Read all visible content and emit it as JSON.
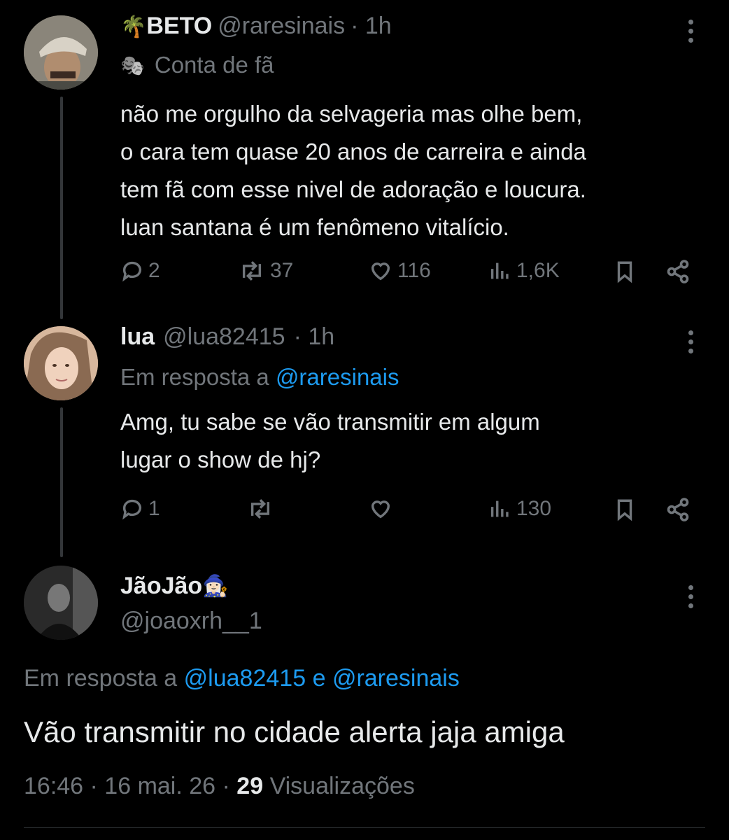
{
  "tweets": [
    {
      "display_name": "BETO",
      "name_emoji": "🌴",
      "handle": "@raresinais",
      "time": "· 1h",
      "label_emoji": "🎭",
      "label": "Conta de fã",
      "body": [
        "não me orgulho da selvageria mas olhe bem,",
        "o cara tem quase 20 anos de carreira e ainda",
        "tem fã com esse nivel de adoração e loucura.",
        "luan santana é um fenômeno vitalício."
      ],
      "stats": {
        "replies": "2",
        "retweets": "37",
        "likes": "116",
        "views": "1,6K"
      }
    },
    {
      "display_name": "lua",
      "handle": "@lua82415",
      "time": "· 1h",
      "reply_prefix": "Em resposta a",
      "reply_to": "@raresinais",
      "body": [
        "Amg, tu sabe se vão transmitir em algum",
        "lugar o show de hj?"
      ],
      "stats": {
        "replies": "1",
        "retweets": "",
        "likes": "",
        "views": "130"
      }
    }
  ],
  "main_tweet": {
    "display_name": "JãoJão",
    "name_emoji": "🧙🏻‍♀️",
    "handle": "@joaoxrh__1",
    "reply_prefix": "Em resposta a",
    "reply_to_1": "@lua82415",
    "reply_joiner": "e",
    "reply_to_2": "@raresinais",
    "body": "Vão transmitir no cidade alerta jaja amiga",
    "time": "16:46 · 16 mai. 26 ·",
    "views_count": "29",
    "views_label": "Visualizações"
  },
  "icons": [
    "more-icon",
    "reply-icon",
    "retweet-icon",
    "like-icon",
    "views-icon",
    "bookmark-icon",
    "share-icon"
  ],
  "colors": {
    "background": "#000000",
    "text": "#e7e9ea",
    "muted": "#71767b",
    "link": "#1d9bf0"
  }
}
